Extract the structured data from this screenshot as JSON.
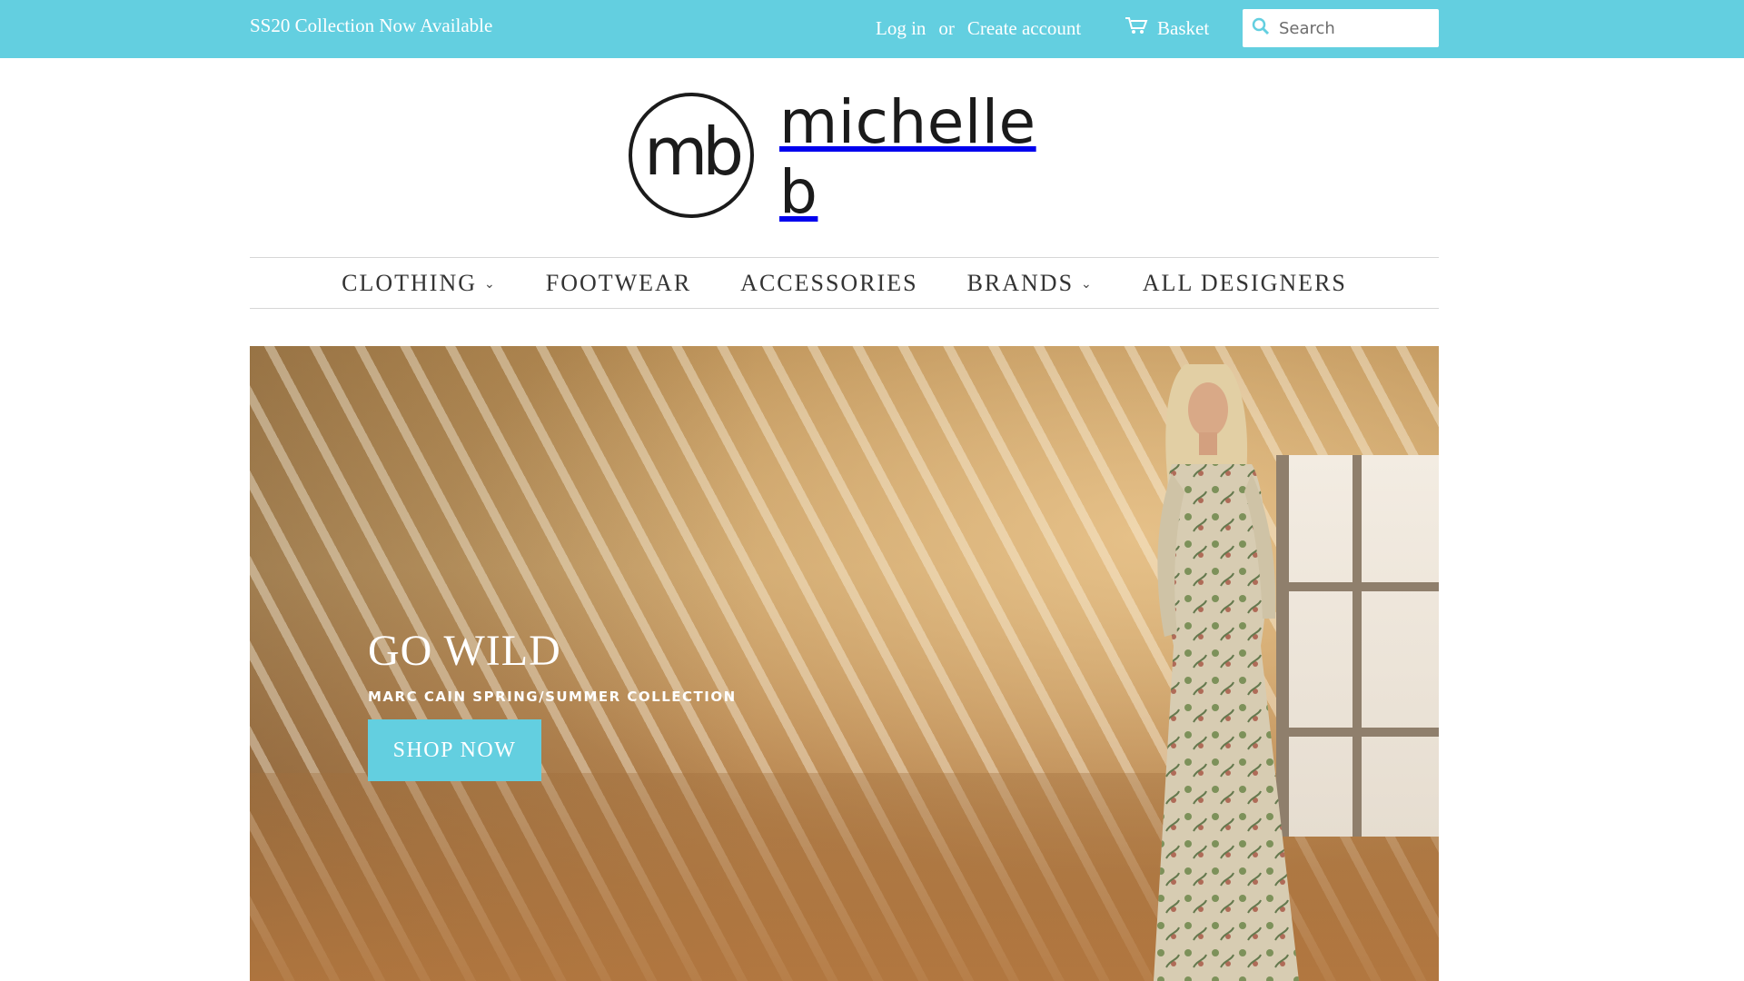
{
  "topbar": {
    "announcement": "SS20 Collection Now Available",
    "login_label": "Log in",
    "or_label": "or",
    "create_account_label": "Create account",
    "basket_label": "Basket",
    "search_placeholder": "Search",
    "background_color": "#63cfe0"
  },
  "logo": {
    "monogram": "mb",
    "wordmark": "michelle b"
  },
  "nav": {
    "items": [
      {
        "label": "CLOTHING",
        "has_dropdown": true
      },
      {
        "label": "FOOTWEAR",
        "has_dropdown": false
      },
      {
        "label": "ACCESSORIES",
        "has_dropdown": false
      },
      {
        "label": "BRANDS",
        "has_dropdown": true
      },
      {
        "label": "ALL DESIGNERS",
        "has_dropdown": false
      }
    ]
  },
  "hero": {
    "title": "GO WILD",
    "subtitle": "MARC CAIN SPRING/SUMMER COLLECTION",
    "button_label": "SHOP NOW",
    "button_color": "#63cfe0"
  },
  "icons": {
    "cart": "cart-icon",
    "search": "search-icon",
    "chevron": "chevron-down-icon"
  }
}
